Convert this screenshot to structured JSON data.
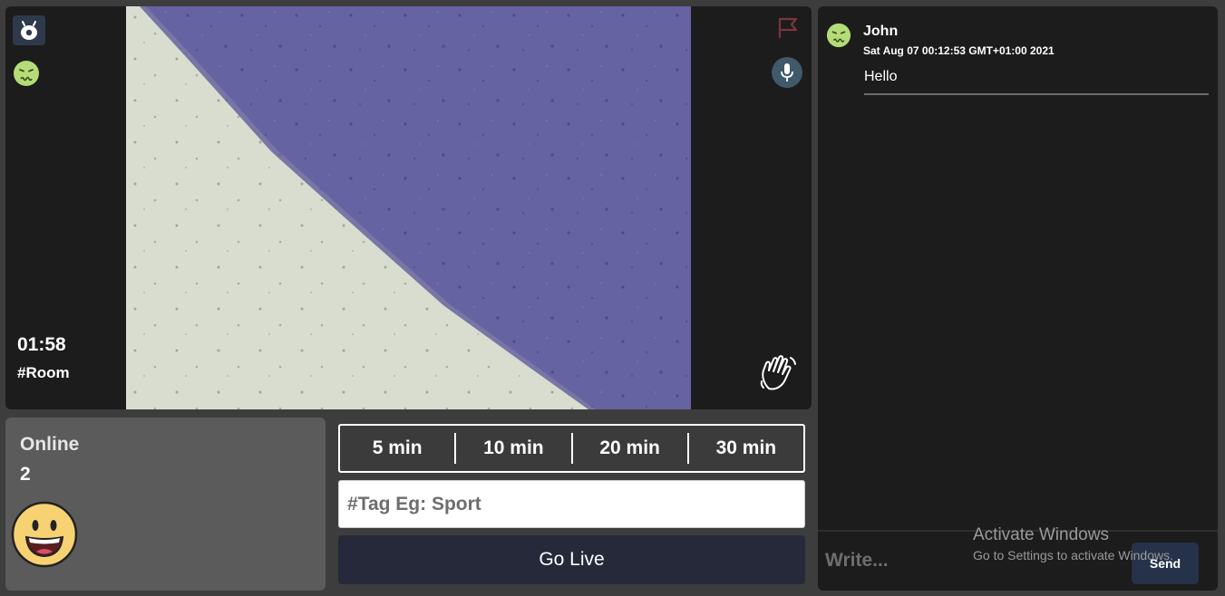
{
  "video": {
    "timer": "01:58",
    "room": "#Room",
    "icons": {
      "logo": "alien-logo-icon",
      "user_status": "sick-emoji-icon",
      "report": "flag-icon",
      "mic": "microphone-icon",
      "wave": "waving-hand-icon"
    }
  },
  "online": {
    "label": "Online",
    "count": "2",
    "emoji": "smiling-face-icon"
  },
  "durations": [
    "5 min",
    "10 min",
    "20 min",
    "30 min"
  ],
  "tag_input": {
    "placeholder": "#Tag Eg: Sport",
    "value": ""
  },
  "go_live_label": "Go Live",
  "chat": {
    "messages": [
      {
        "name": "John",
        "time": "Sat Aug 07 00:12:53 GMT+01:00 2021",
        "text": "Hello",
        "avatar": "sick-emoji-icon"
      }
    ],
    "input_placeholder": "Write...",
    "send_label": "Send"
  },
  "watermark": {
    "title": "Activate Windows",
    "subtitle": "Go to Settings to activate Windows."
  },
  "colors": {
    "background": "#3d3d3d",
    "panel": "#1c1c1c",
    "online_panel": "#5b5b5b",
    "go_live": "#25293a",
    "send": "#26324a",
    "flag": "#7b3440",
    "mic_bg": "#40596b",
    "emoji_green": "#b4dc78"
  }
}
